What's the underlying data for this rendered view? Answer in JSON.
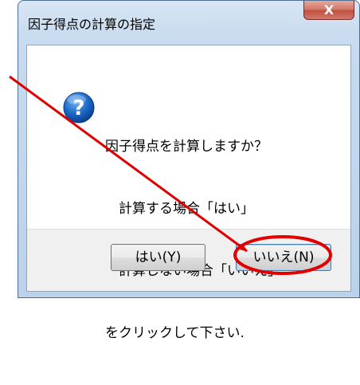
{
  "dialog": {
    "title": "因子得点の計算の指定",
    "close_label": "X",
    "icon": "question-icon",
    "message_lines": [
      "因子得点を計算しますか？",
      "　計算する場合「はい」",
      "　計算しない場合「いいえ」",
      "をクリックして下さい."
    ],
    "buttons": {
      "yes_label": "はい(Y)",
      "no_label": "いいえ(N)"
    }
  },
  "annotation": {
    "arrow_color": "#e00000",
    "highlight": "no-button"
  }
}
